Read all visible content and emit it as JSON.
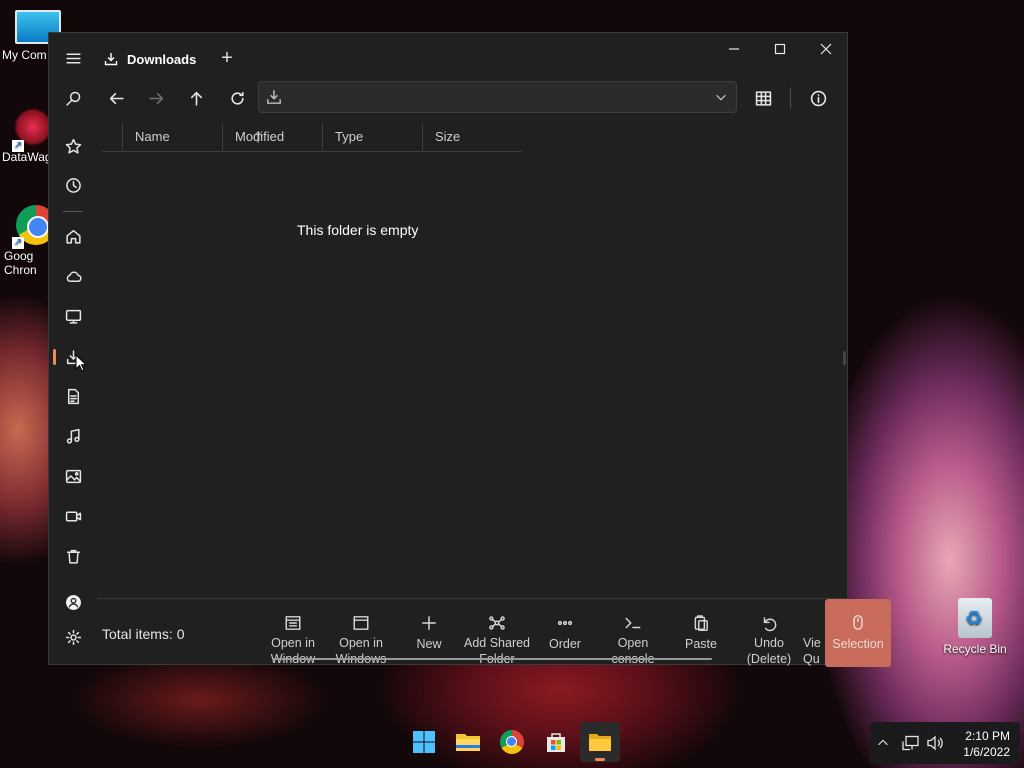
{
  "desktop": {
    "icons": [
      {
        "label": "My Com"
      },
      {
        "label": "DataWag"
      },
      {
        "label": "Goog\nChron"
      },
      {
        "label": "Recycle Bin"
      }
    ]
  },
  "window": {
    "tab_title": "Downloads",
    "new_tab_symbol": "+",
    "address_value": "",
    "columns": [
      "Name",
      "Modified",
      "Type",
      "Size"
    ],
    "empty_message": "This folder is empty",
    "rail_icons": [
      "menu-icon",
      "search-icon",
      "star-icon",
      "clock-icon",
      "home-icon",
      "cloud-icon",
      "desktop-icon",
      "downloads-icon",
      "document-icon",
      "music-icon",
      "pictures-icon",
      "video-icon",
      "trash-icon",
      "user-icon",
      "settings-icon"
    ],
    "status": {
      "total_items": "Total items: 0",
      "actions": [
        {
          "label": "Open in\nWindow",
          "icon": "window-icon"
        },
        {
          "label": "Open in\nWindows",
          "icon": "window-icon"
        },
        {
          "label": "New",
          "icon": "plus-icon"
        },
        {
          "label": "Add Shared\nFolder",
          "icon": "share-icon"
        },
        {
          "label": "Order",
          "icon": "dots-icon"
        },
        {
          "label": "Open\nconsole",
          "icon": "console-icon"
        },
        {
          "label": "Paste",
          "icon": "paste-icon"
        },
        {
          "label": "Undo\n(Delete)",
          "icon": "undo-icon"
        },
        {
          "label": "Vie\nQu",
          "icon": "view-icon"
        },
        {
          "label": "Selection",
          "icon": "mouse-icon"
        }
      ]
    }
  },
  "taskbar": {
    "apps": [
      "windows-start-icon",
      "file-explorer-icon",
      "chrome-icon",
      "store-icon",
      "files-app-icon"
    ],
    "time": "2:10 PM",
    "date": "1/6/2022"
  },
  "colors": {
    "window_bg": "#202020",
    "accent": "#f08a5d",
    "selection_bg": "#c86b5a"
  }
}
